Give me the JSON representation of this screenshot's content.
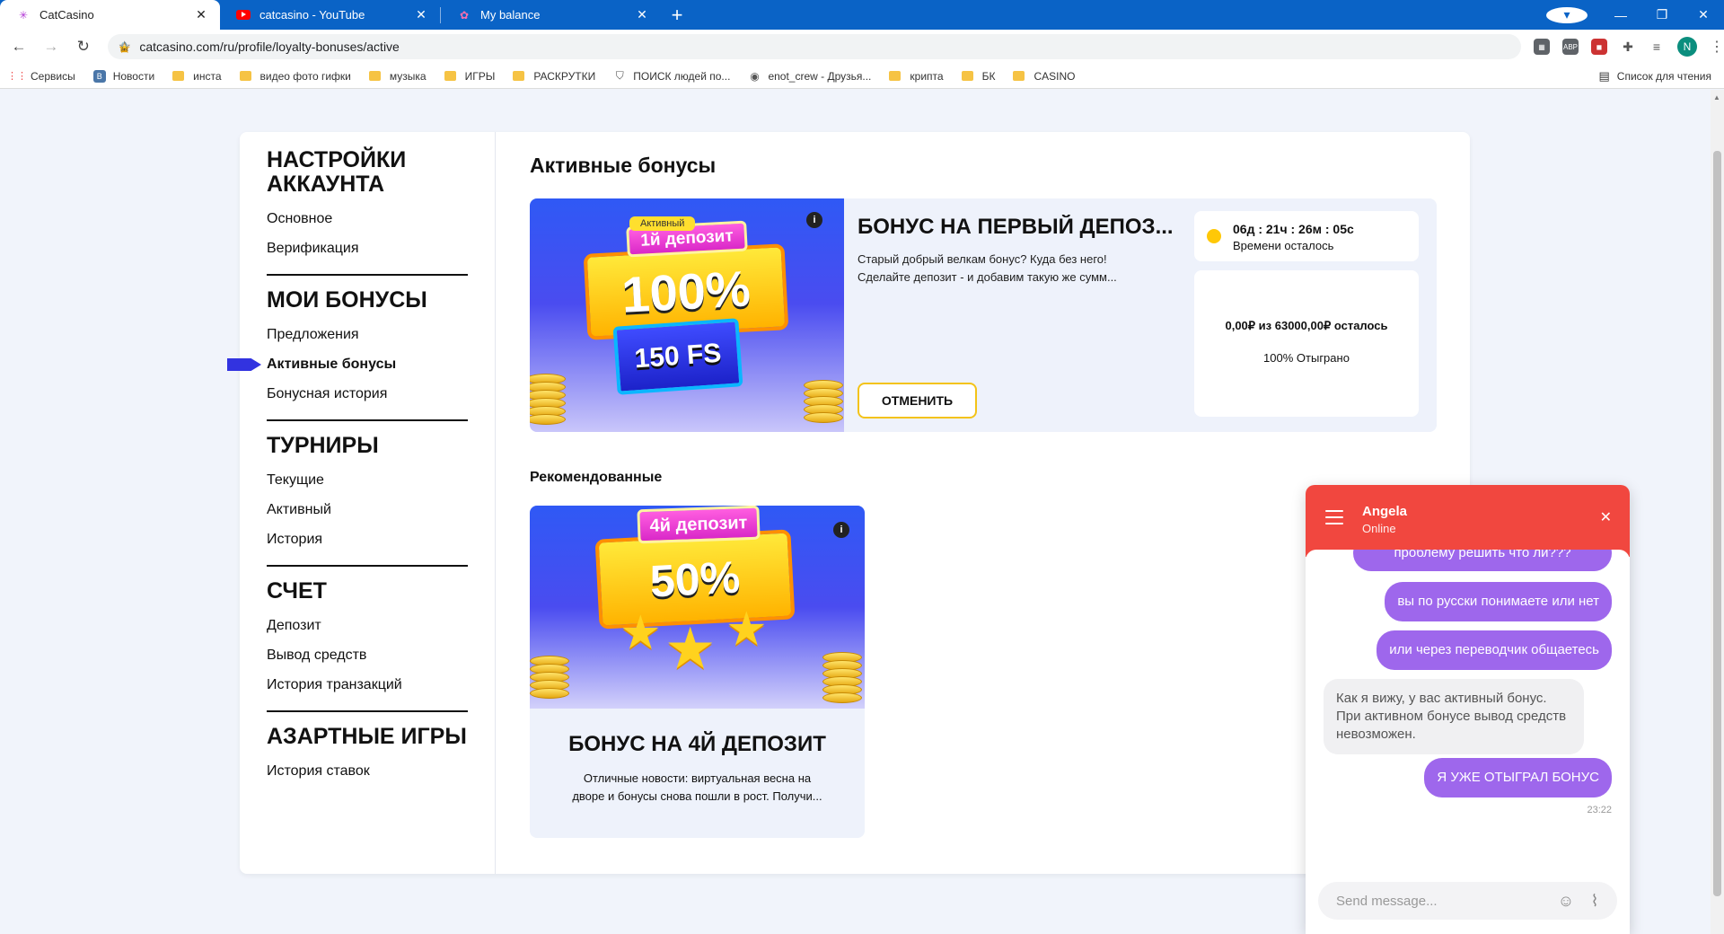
{
  "browser": {
    "tabs": [
      {
        "title": "CatCasino",
        "active": true
      },
      {
        "title": "catcasino - YouTube",
        "active": false
      },
      {
        "title": "My balance",
        "active": false
      }
    ],
    "new_tab": "+",
    "url": "catcasino.com/ru/profile/loyalty-bonuses/active",
    "profile_initial": "N",
    "bookmarks": [
      "Сервисы",
      "Новости",
      "инста",
      "видео фото гифки",
      "музыка",
      "ИГРЫ",
      "РАСКРУТКИ",
      "ПОИСК людей по...",
      "enot_crew - Друзья...",
      "крипта",
      "БК",
      "CASINO"
    ],
    "reading_list": "Список для чтения",
    "ext_abp": "ABP"
  },
  "sidebar": {
    "sections": [
      {
        "title": "НАСТРОЙКИ АККАУНТА",
        "items": [
          "Основное",
          "Верификация"
        ]
      },
      {
        "title": "МОИ БОНУСЫ",
        "items": [
          "Предложения",
          "Активные бонусы",
          "Бонусная история"
        ]
      },
      {
        "title": "ТУРНИРЫ",
        "items": [
          "Текущие",
          "Активный",
          "История"
        ]
      },
      {
        "title": "СЧЕТ",
        "items": [
          "Депозит",
          "Вывод средств",
          "История транзакций"
        ]
      },
      {
        "title": "АЗАРТНЫЕ ИГРЫ",
        "items": [
          "История ставок"
        ]
      }
    ],
    "active_item": "Активные бонусы"
  },
  "main": {
    "title": "Активные бонусы",
    "active_bonus": {
      "badge": "Активный",
      "img_tag": "1й депозит",
      "img_big": "100%",
      "img_fs": "150 FS",
      "title": "БОНУС НА ПЕРВЫЙ ДЕПОЗ...",
      "desc_line1": "Старый добрый велкам бонус? Куда без него!",
      "desc_line2": "Сделайте депозит - и добавим такую же сумм...",
      "cancel_label": "ОТМЕНИТЬ",
      "timer_value": "06д : 21ч : 26м : 05с",
      "timer_label": "Времени осталось",
      "progress_amount": "0,00₽ из 63000,00₽ осталось",
      "progress_percent": "100% Отыграно"
    },
    "recommended_title": "Рекомендованные",
    "recommended": {
      "img_tag": "4й депозит",
      "img_big": "50%",
      "title": "БОНУС НА 4Й ДЕПОЗИТ",
      "desc_line1": "Отличные новости: виртуальная весна на",
      "desc_line2": "дворе и бонусы снова пошли в рост. Получи..."
    }
  },
  "chat": {
    "agent_name": "Angela",
    "agent_status": "Online",
    "messages": [
      {
        "from": "user",
        "text": "проблему решить что ли???"
      },
      {
        "from": "user",
        "text": "вы по русски понимаете или нет"
      },
      {
        "from": "user",
        "text": "или через переводчик общаетесь"
      },
      {
        "from": "agent",
        "text": "Как я вижу, у вас активный бонус. При активном бонусе вывод средств невозможен."
      },
      {
        "from": "user",
        "text": "Я УЖЕ ОТЫГРАЛ БОНУС"
      }
    ],
    "last_time": "23:22",
    "input_placeholder": "Send message..."
  },
  "colors": {
    "browser_blue": "#0a63c6",
    "chat_header": "#f1473f",
    "chat_bubble": "#9e67ec",
    "accent_yellow": "#f3c318",
    "active_marker": "#3233e0"
  }
}
